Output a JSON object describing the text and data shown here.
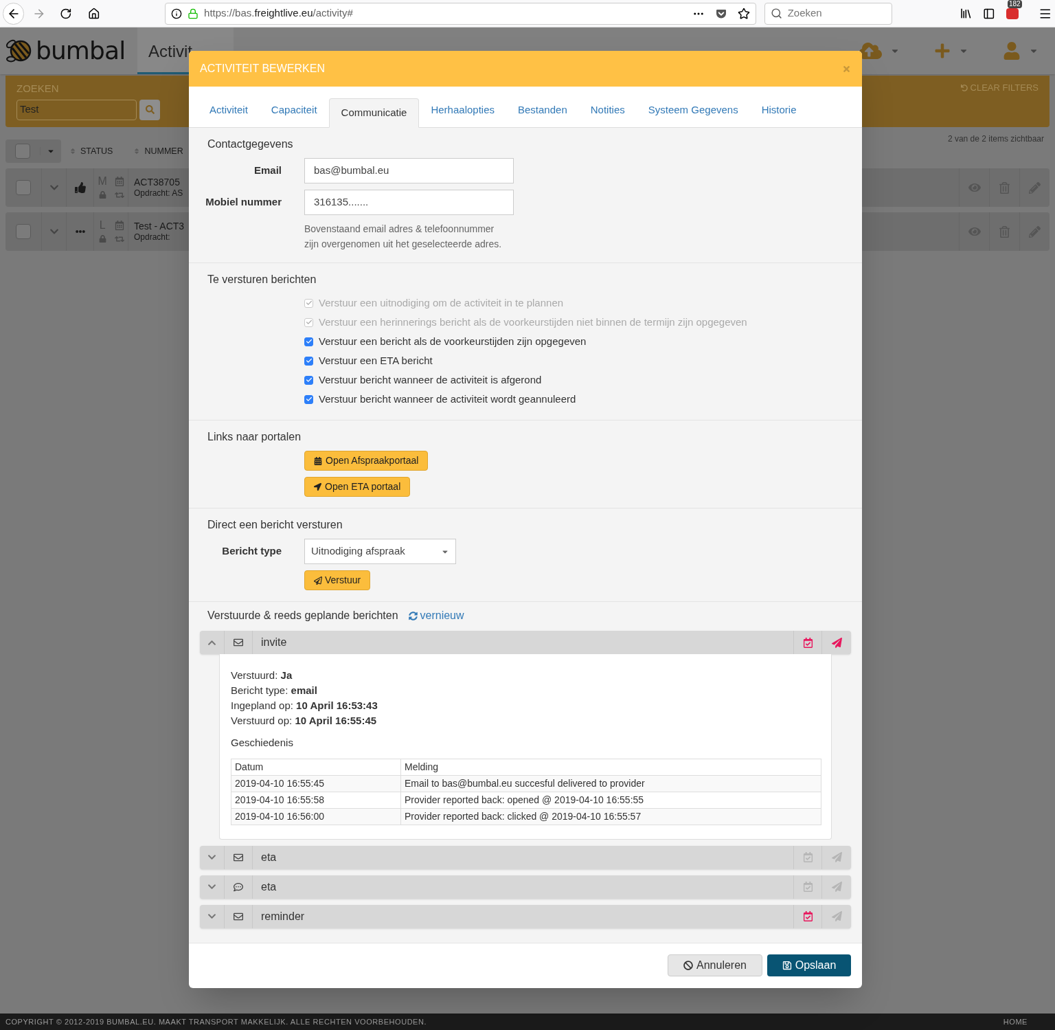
{
  "browser": {
    "url_prefix": "https://bas.",
    "url_domain": "freightlive.eu",
    "url_suffix": "/activity#",
    "search_placeholder": "Zoeken",
    "badge": "182"
  },
  "app": {
    "logo": "bumbal",
    "nav_tab": "Activit",
    "search_label": "ZOEKEN",
    "search_value": "Test",
    "clear_filters": "CLEAR FILTERS",
    "count": "2 van de 2 items zichtbaar",
    "select_all_checked": false,
    "columns": [
      "STATUS",
      "NUMMER"
    ],
    "rows": [
      {
        "kind": "thumbs",
        "letter": "M",
        "title": "ACT38705",
        "subtitle": "Opdracht: AS",
        "checked": false
      },
      {
        "kind": "dots",
        "letter": "L",
        "title": "Test - ACT3",
        "subtitle": "Opdracht:",
        "checked": false
      }
    ]
  },
  "modal": {
    "title": "ACTIVITEIT BEWERKEN",
    "tabs": [
      {
        "label": "Activiteit",
        "selected": false
      },
      {
        "label": "Capaciteit",
        "selected": false
      },
      {
        "label": "Communicatie",
        "selected": true
      },
      {
        "label": "Herhaalopties",
        "selected": false
      },
      {
        "label": "Bestanden",
        "selected": false
      },
      {
        "label": "Notities",
        "selected": false
      },
      {
        "label": "Systeem Gegevens",
        "selected": false
      },
      {
        "label": "Historie",
        "selected": false
      }
    ],
    "contact": {
      "heading": "Contactgegevens",
      "fields": [
        {
          "label": "Email",
          "value": "bas@bumbal.eu"
        },
        {
          "label": "Mobiel nummer",
          "value": "316135......."
        }
      ],
      "hint": "Bovenstaand email adres & telefoonnummer zijn overgenomen uit het geselecteerde adres."
    },
    "messages": {
      "heading": "Te versturen berichten",
      "options": [
        {
          "label": "Verstuur een uitnodiging om de activiteit in te plannen",
          "checked": true,
          "disabled": true
        },
        {
          "label": "Verstuur een herinnerings bericht als de voorkeurstijden niet binnen de termijn zijn opgegeven",
          "checked": true,
          "disabled": true
        },
        {
          "label": "Verstuur een bericht als de voorkeurstijden zijn opgegeven",
          "checked": true,
          "disabled": false
        },
        {
          "label": "Verstuur een ETA bericht",
          "checked": true,
          "disabled": false
        },
        {
          "label": "Verstuur bericht wanneer de activiteit is afgerond",
          "checked": true,
          "disabled": false
        },
        {
          "label": "Verstuur bericht wanneer de activiteit wordt geannuleerd",
          "checked": true,
          "disabled": false
        }
      ]
    },
    "portals": {
      "heading": "Links naar portalen",
      "buttons": [
        {
          "label": "Open Afspraakportaal",
          "kind": "calendar"
        },
        {
          "label": "Open ETA portaal",
          "kind": "arrow"
        }
      ]
    },
    "direct": {
      "heading": "Direct een bericht versturen",
      "label": "Bericht type",
      "select_value": "Uitnodiging afspraak",
      "button": "Verstuur"
    },
    "sent": {
      "heading": "Verstuurde & reeds geplande berichten",
      "refresh": "vernieuw",
      "items": [
        {
          "name": "invite",
          "kind": "email",
          "expanded": true,
          "planned_active": true,
          "send_active": true,
          "details": [
            "Verstuurd: **Ja**",
            "Bericht type: **email**",
            "Ingepland op: **10 April 16:53:43**",
            "Verstuurd op: **10 April 16:55:45**"
          ],
          "history_heading": "Geschiedenis",
          "history_columns": [
            "Datum",
            "Melding"
          ],
          "history_rows": [
            [
              "2019-04-10 16:55:45",
              "Email to bas@bumbal.eu succesful delivered to provider"
            ],
            [
              "2019-04-10 16:55:58",
              "Provider reported back: opened @ 2019-04-10 16:55:55"
            ],
            [
              "2019-04-10 16:56:00",
              "Provider reported back: clicked @ 2019-04-10 16:55:57"
            ]
          ]
        },
        {
          "name": "eta",
          "kind": "email",
          "expanded": false,
          "planned_active": false,
          "send_active": false
        },
        {
          "name": "eta",
          "kind": "sms",
          "expanded": false,
          "planned_active": false,
          "send_active": false
        },
        {
          "name": "reminder",
          "kind": "email",
          "expanded": false,
          "planned_active": true,
          "send_active": false
        }
      ]
    },
    "cancel": "Annuleren",
    "save": "Opslaan"
  },
  "footer": {
    "copyright": "COPYRIGHT © 2012-2019 BUMBAL.EU. MAAKT TRANSPORT MAKKELIJK. ALLE RECHTEN VOORBEHOUDEN.",
    "home": "HOME"
  }
}
